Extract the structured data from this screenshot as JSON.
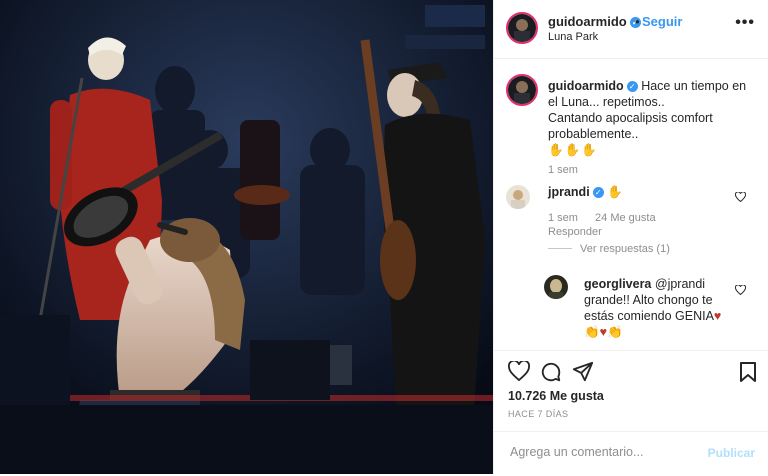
{
  "post": {
    "username": "guidoarmido",
    "follow_label": "Seguir",
    "dot": "•",
    "location": "Luna Park",
    "more_label": "•••"
  },
  "caption": {
    "username": "guidoarmido",
    "text_line1": "Hace un tiempo en el Luna... repetimos..",
    "text_line2": "Cantando apocalipsis comfort probablemente..",
    "emoji": "✋✋✋",
    "time": "1 sem"
  },
  "comments": [
    {
      "username": "jprandi",
      "text": "✋",
      "time": "1 sem",
      "likes": "24 Me gusta",
      "reply_label": "Responder",
      "view_replies": "Ver respuestas (1)"
    },
    {
      "username": "georglivera",
      "text": "@jprandi grande!! Alto chongo te estás comiendo GENIA",
      "emoji": "♥ 👏♥👏"
    }
  ],
  "stats": {
    "likes": "10.726 Me gusta",
    "time_ago": "HACE 7 DÍAS"
  },
  "comment_box": {
    "placeholder": "Agrega un comentario...",
    "post_label": "Publicar"
  },
  "icons": {
    "like": "heart-icon",
    "comment": "comment-icon",
    "share": "share-icon",
    "save": "bookmark-icon"
  },
  "colors": {
    "link": "#3897f0",
    "muted": "#8e8e8e",
    "post_disabled": "#b2dffc"
  }
}
